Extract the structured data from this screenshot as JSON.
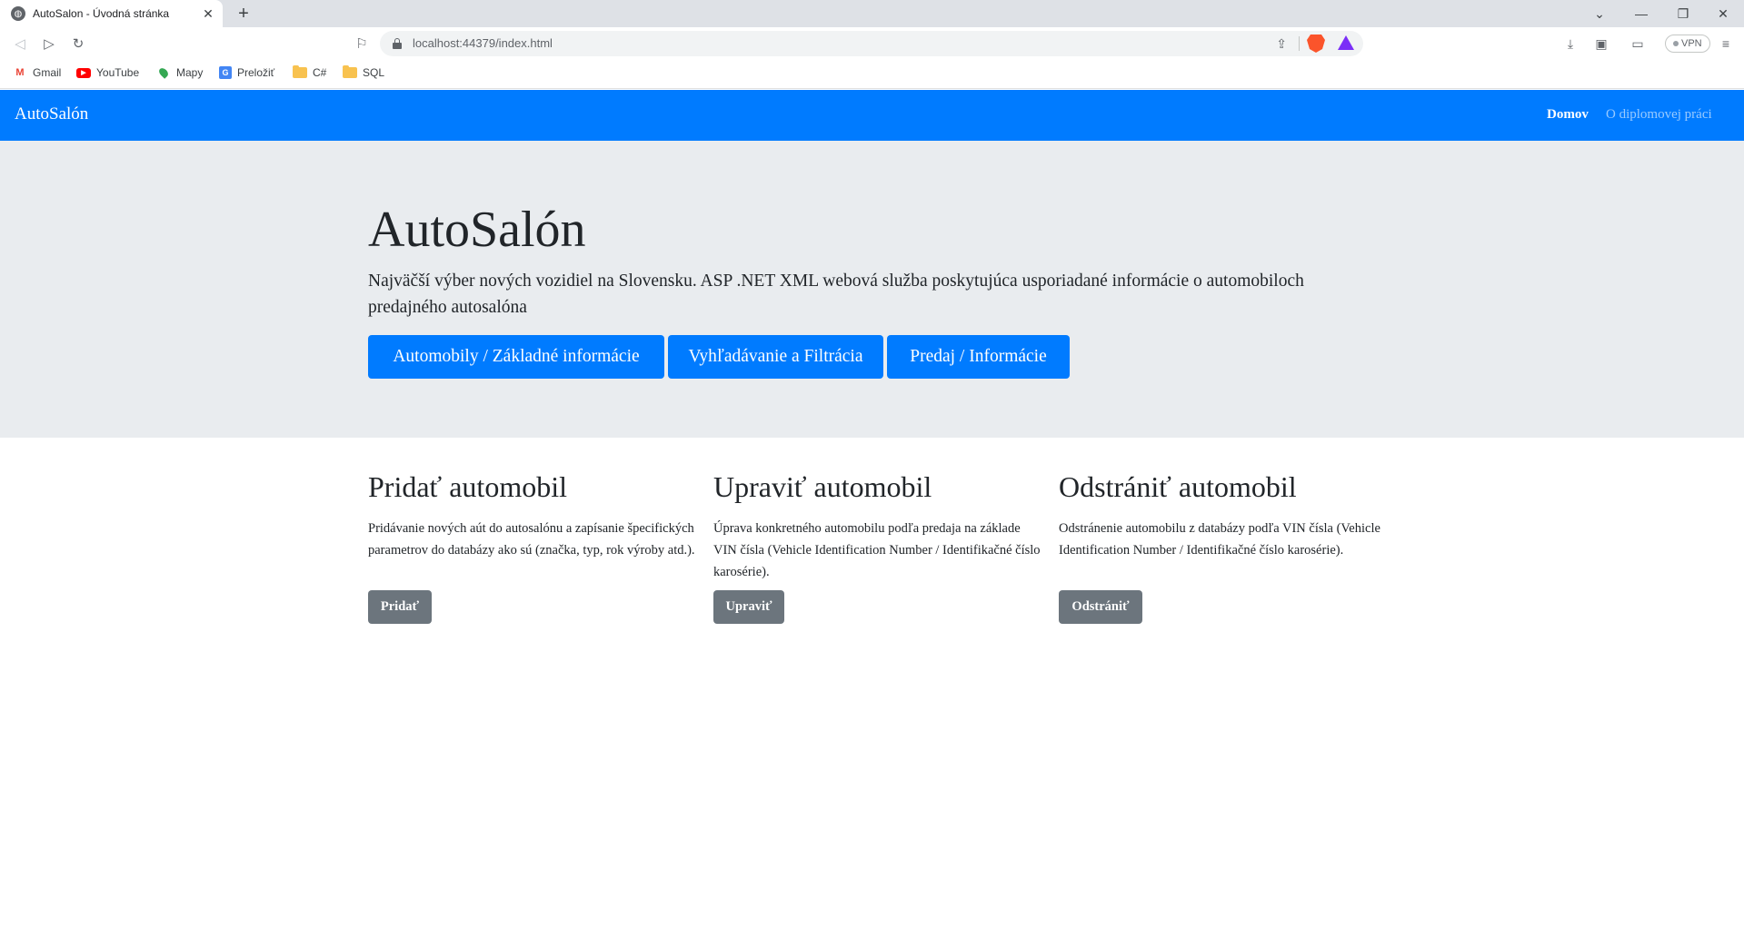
{
  "browser": {
    "tab_title": "AutoSalon - Úvodná stránka",
    "tab_close": "✕",
    "new_tab": "+",
    "url": "localhost:44379/index.html",
    "vpn_label": "VPN",
    "bookmarks": [
      {
        "label": "Gmail",
        "icon": "gmail-icon"
      },
      {
        "label": "YouTube",
        "icon": "youtube-icon"
      },
      {
        "label": "Mapy",
        "icon": "maps-icon"
      },
      {
        "label": "Preložiť",
        "icon": "translate-icon"
      },
      {
        "label": "C#",
        "icon": "folder-icon"
      },
      {
        "label": "SQL",
        "icon": "folder-icon"
      }
    ],
    "brave_color": "#fb542b",
    "tabstrip_color": "#dee1e6"
  },
  "navbar": {
    "brand": "AutoSalón",
    "links": [
      {
        "label": "Domov"
      },
      {
        "label": "O diplomovej práci"
      }
    ],
    "color": "#007bff"
  },
  "jumbotron": {
    "title": "AutoSalón",
    "lead": "Najväčší výber nových vozidiel na Slovensku. ASP .NET XML webová služba poskytujúca usporiadané informácie o automobiloch predajného autosalóna",
    "buttons": [
      {
        "label": "Automobily / Základné informácie"
      },
      {
        "label": "Vyhľadávanie a Filtrácia"
      },
      {
        "label": "Predaj / Informácie"
      }
    ]
  },
  "features": [
    {
      "title": "Pridať automobil",
      "text": "Pridávanie nových aút do autosalónu a zapísanie špecifických parametrov do databázy ako sú (značka, typ, rok výroby atd.).",
      "button": "Pridať"
    },
    {
      "title": "Upraviť automobil",
      "text": "Úprava konkretného automobilu podľa predaja na základe VIN čísla (Vehicle Identification Number / Identifikačné číslo karosérie).",
      "button": "Upraviť"
    },
    {
      "title": "Odstrániť automobil",
      "text": "Odstránenie automobilu z databázy podľa VIN čísla (Vehicle Identification Number / Identifikačné číslo karosérie).",
      "button": "Odstrániť"
    }
  ]
}
